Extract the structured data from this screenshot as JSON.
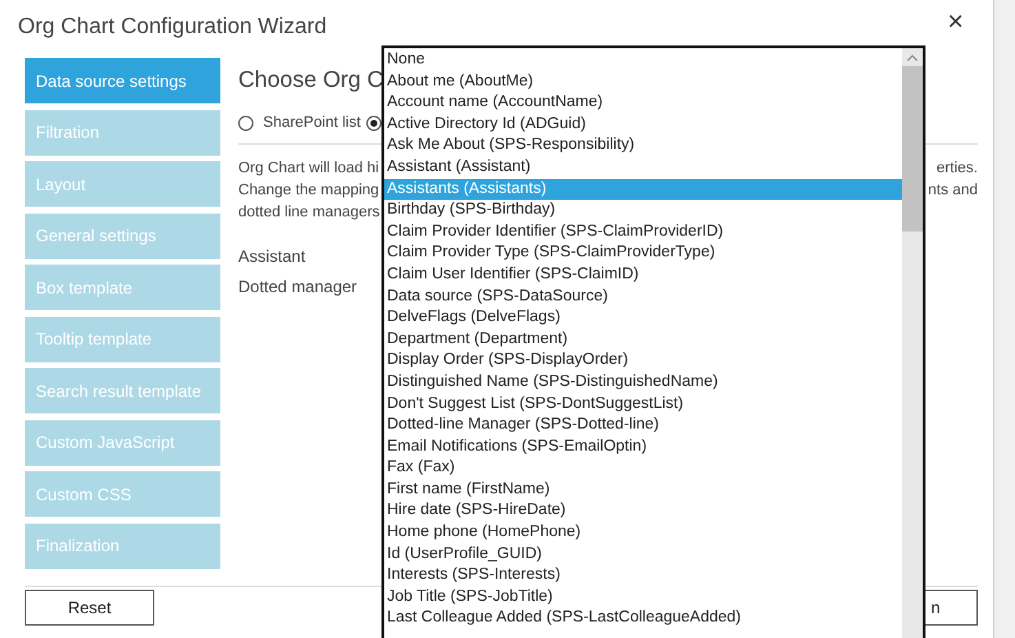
{
  "window": {
    "title": "Org Chart Configuration Wizard",
    "close": "×"
  },
  "sidebar": {
    "items": [
      {
        "label": "Data source settings",
        "selected": true
      },
      {
        "label": "Filtration",
        "selected": false
      },
      {
        "label": "Layout",
        "selected": false
      },
      {
        "label": "General settings",
        "selected": false
      },
      {
        "label": "Box template",
        "selected": false
      },
      {
        "label": "Tooltip template",
        "selected": false
      },
      {
        "label": "Search result template",
        "selected": false
      },
      {
        "label": "Custom JavaScript",
        "selected": false
      },
      {
        "label": "Custom CSS",
        "selected": false
      },
      {
        "label": "Finalization",
        "selected": false
      }
    ]
  },
  "content": {
    "heading": "Choose Org C",
    "source_options": [
      {
        "label": "SharePoint list",
        "selected": false
      },
      {
        "selected": true
      }
    ],
    "description_lines": [
      {
        "left": "Org Chart will load hi",
        "right": "erties."
      },
      {
        "left": "Change the mapping",
        "right": "nts and"
      },
      {
        "left": "dotted line managers"
      }
    ],
    "fields": [
      {
        "label": "Assistant"
      },
      {
        "label": "Dotted manager"
      }
    ]
  },
  "dropdown": {
    "options": [
      {
        "label": "None",
        "selected": false
      },
      {
        "label": "About me (AboutMe)",
        "selected": false
      },
      {
        "label": "Account name (AccountName)",
        "selected": false
      },
      {
        "label": "Active Directory Id (ADGuid)",
        "selected": false
      },
      {
        "label": "Ask Me About (SPS-Responsibility)",
        "selected": false
      },
      {
        "label": "Assistant (Assistant)",
        "selected": false
      },
      {
        "label": "Assistants (Assistants)",
        "selected": true
      },
      {
        "label": "Birthday (SPS-Birthday)",
        "selected": false
      },
      {
        "label": "Claim Provider Identifier (SPS-ClaimProviderID)",
        "selected": false
      },
      {
        "label": "Claim Provider Type (SPS-ClaimProviderType)",
        "selected": false
      },
      {
        "label": "Claim User Identifier (SPS-ClaimID)",
        "selected": false
      },
      {
        "label": "Data source (SPS-DataSource)",
        "selected": false
      },
      {
        "label": "DelveFlags (DelveFlags)",
        "selected": false
      },
      {
        "label": "Department (Department)",
        "selected": false
      },
      {
        "label": "Display Order (SPS-DisplayOrder)",
        "selected": false
      },
      {
        "label": "Distinguished Name (SPS-DistinguishedName)",
        "selected": false
      },
      {
        "label": "Don't Suggest List (SPS-DontSuggestList)",
        "selected": false
      },
      {
        "label": "Dotted-line Manager (SPS-Dotted-line)",
        "selected": false
      },
      {
        "label": "Email Notifications (SPS-EmailOptin)",
        "selected": false
      },
      {
        "label": "Fax (Fax)",
        "selected": false
      },
      {
        "label": "First name (FirstName)",
        "selected": false
      },
      {
        "label": "Hire date (SPS-HireDate)",
        "selected": false
      },
      {
        "label": "Home phone (HomePhone)",
        "selected": false
      },
      {
        "label": "Id (UserProfile_GUID)",
        "selected": false
      },
      {
        "label": "Interests (SPS-Interests)",
        "selected": false
      },
      {
        "label": "Job Title (SPS-JobTitle)",
        "selected": false
      },
      {
        "label": "Last Colleague Added (SPS-LastColleagueAdded)",
        "selected": false
      }
    ]
  },
  "footer": {
    "buttons": [
      {
        "label": "Reset"
      },
      {
        "label": "n"
      }
    ]
  }
}
